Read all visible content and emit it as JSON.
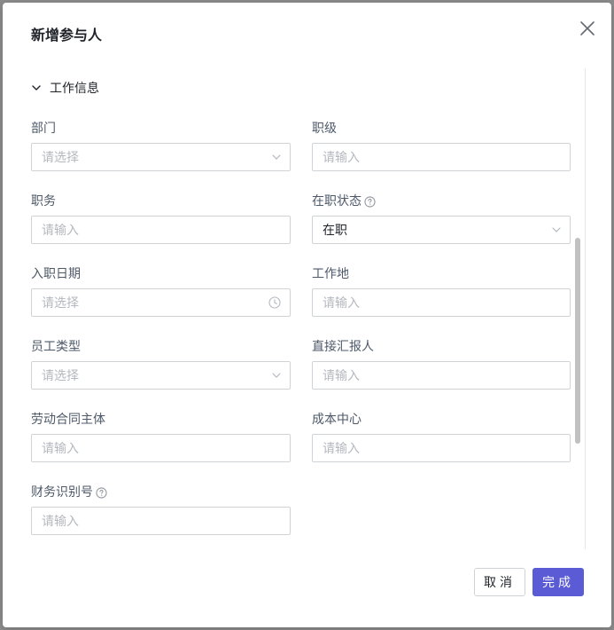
{
  "dialog": {
    "title": "新增参与人",
    "close_icon": "close-icon"
  },
  "section": {
    "title": "工作信息",
    "icon": "chevron-down-icon"
  },
  "fields": {
    "department": {
      "label": "部门",
      "placeholder": "请选择",
      "icon": "chevron-down-icon"
    },
    "rank": {
      "label": "职级",
      "placeholder": "请输入"
    },
    "position": {
      "label": "职务",
      "placeholder": "请输入"
    },
    "employment_status": {
      "label": "在职状态",
      "value": "在职",
      "icon": "chevron-down-icon",
      "help_icon": "help-circle-icon"
    },
    "hire_date": {
      "label": "入职日期",
      "placeholder": "请选择",
      "icon": "clock-icon"
    },
    "work_location": {
      "label": "工作地",
      "placeholder": "请输入"
    },
    "employee_type": {
      "label": "员工类型",
      "placeholder": "请选择",
      "icon": "chevron-down-icon"
    },
    "direct_manager": {
      "label": "直接汇报人",
      "placeholder": "请输入"
    },
    "contract_entity": {
      "label": "劳动合同主体",
      "placeholder": "请输入"
    },
    "cost_center": {
      "label": "成本中心",
      "placeholder": "请输入"
    },
    "finance_id": {
      "label": "财务识别号",
      "placeholder": "请输入",
      "help_icon": "help-circle-icon"
    }
  },
  "footer": {
    "cancel_label": "取消",
    "ok_label": "完成"
  },
  "colors": {
    "primary": "#5b5bd6",
    "border": "#d0d3d6",
    "placeholder": "#b4b8bf",
    "label": "#4e5969"
  }
}
